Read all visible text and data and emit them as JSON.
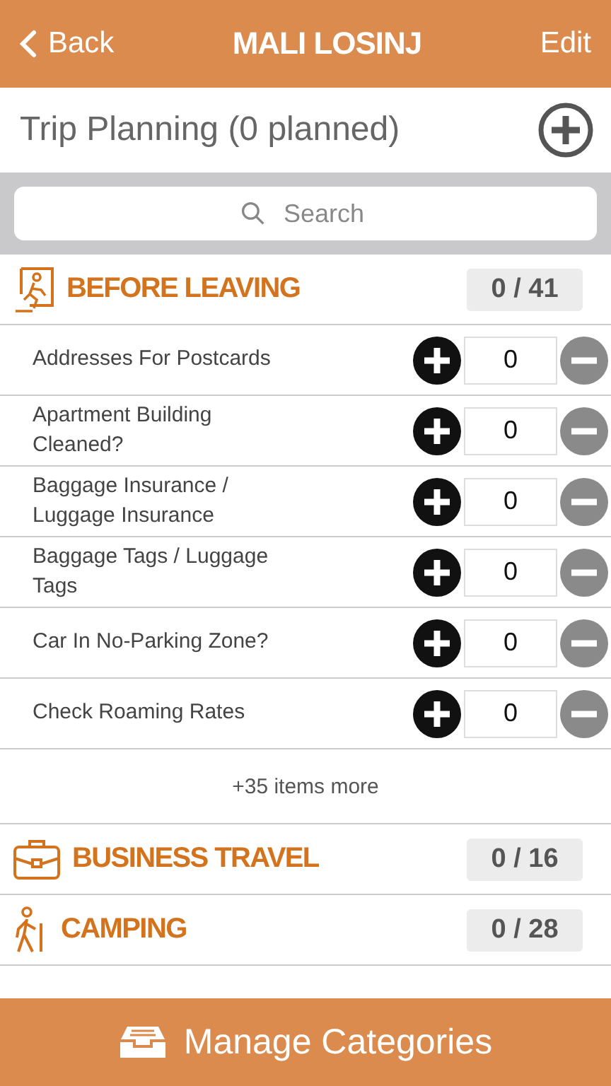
{
  "nav_bar": {
    "back": "Back",
    "title": "MALI LOSINJ",
    "edit": "Edit"
  },
  "plan_header": {
    "title": "Trip Planning (0 planned)"
  },
  "search": {
    "placeholder": "Search"
  },
  "categories": [
    {
      "kind": "exit",
      "name": "BEFORE LEAVING",
      "count": "0 / 41",
      "items": [
        {
          "name": "Addresses For Postcards",
          "value": "0"
        },
        {
          "name": "Apartment Building Cleaned?",
          "value": "0"
        },
        {
          "name": "Baggage Insurance / Luggage Insurance",
          "value": "0"
        },
        {
          "name": "Baggage Tags / Luggage Tags",
          "value": "0"
        },
        {
          "name": "Car In No-Parking Zone?",
          "value": "0"
        },
        {
          "name": "Check Roaming Rates",
          "value": "0"
        }
      ],
      "more": "+35 items more"
    },
    {
      "kind": "briefcase",
      "name": "BUSINESS TRAVEL",
      "count": "0 / 16"
    },
    {
      "kind": "hiker",
      "name": "CAMPING",
      "count": "0 / 28"
    }
  ],
  "bottom_bar": {
    "label": "Manage Categories"
  }
}
